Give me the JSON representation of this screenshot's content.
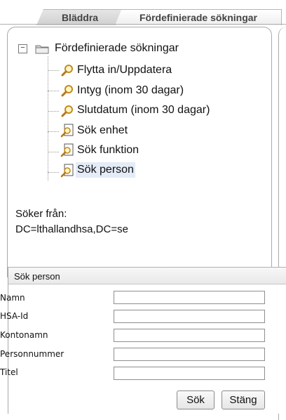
{
  "tabs": [
    {
      "label": "Bläddra"
    },
    {
      "label": "Fördefinierade sökningar"
    }
  ],
  "tree": {
    "root": {
      "label": "Fördefinierade sökningar",
      "expanded": true,
      "icon": "folder-icon"
    },
    "items": [
      {
        "label": "Flytta in/Uppdatera",
        "icon": "magnifier-icon"
      },
      {
        "label": "Intyg (inom 30 dagar)",
        "icon": "magnifier-icon"
      },
      {
        "label": "Slutdatum (inom 30 dagar)",
        "icon": "magnifier-icon"
      },
      {
        "label": "Sök enhet",
        "icon": "search-document-icon"
      },
      {
        "label": "Sök funktion",
        "icon": "search-document-icon"
      },
      {
        "label": "Sök person",
        "icon": "search-document-icon",
        "selected": true
      }
    ]
  },
  "search_scope": {
    "label": "Söker från:",
    "value": "DC=lthallandhsa,DC=se"
  },
  "form": {
    "title": "Sök person",
    "fields": [
      {
        "label": "Namn",
        "value": ""
      },
      {
        "label": "HSA-Id",
        "value": ""
      },
      {
        "label": "Kontonamn",
        "value": ""
      },
      {
        "label": "Personnummer",
        "value": ""
      },
      {
        "label": "Titel",
        "value": ""
      }
    ],
    "search_button": "Sök",
    "close_button": "Stäng"
  }
}
